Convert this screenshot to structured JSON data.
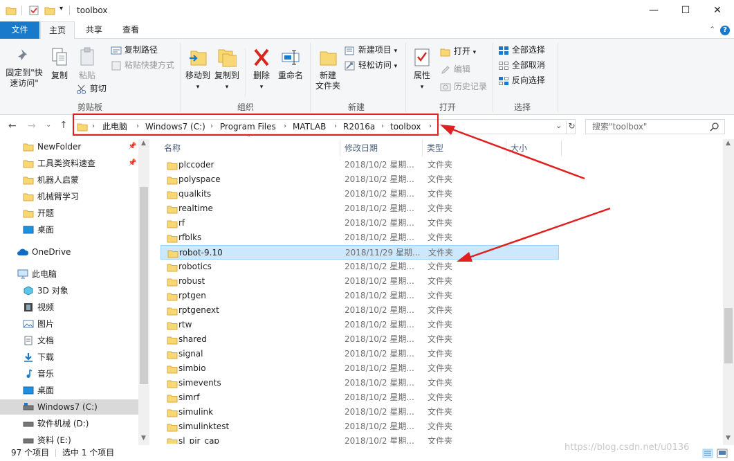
{
  "window": {
    "title": "toolbox",
    "controls": {
      "minimize": "—",
      "maximize": "☐",
      "close": "✕"
    }
  },
  "ribbon_tabs": [
    {
      "label": "文件"
    },
    {
      "label": "主页"
    },
    {
      "label": "共享"
    },
    {
      "label": "查看"
    }
  ],
  "ribbon": {
    "clipboard": {
      "group_label": "剪贴板",
      "pin_quick_line1": "固定到\"快",
      "pin_quick_line2": "速访问\"",
      "copy": "复制",
      "paste": "粘贴",
      "copy_path": "复制路径",
      "paste_shortcut": "粘贴快捷方式",
      "cut": "剪切"
    },
    "organize": {
      "group_label": "组织",
      "move_to": "移动到",
      "copy_to": "复制到",
      "delete": "删除",
      "rename": "重命名"
    },
    "new": {
      "group_label": "新建",
      "new_folder_line1": "新建",
      "new_folder_line2": "文件夹",
      "new_item": "新建项目",
      "easy_access": "轻松访问"
    },
    "open": {
      "group_label": "打开",
      "properties": "属性",
      "open": "打开",
      "edit": "编辑",
      "history": "历史记录"
    },
    "select": {
      "group_label": "选择",
      "select_all": "全部选择",
      "select_none": "全部取消",
      "invert": "反向选择"
    }
  },
  "address": {
    "crumbs": [
      "此电脑",
      "Windows7 (C:)",
      "Program Files",
      "MATLAB",
      "R2016a",
      "toolbox"
    ],
    "search_placeholder": "搜索\"toolbox\""
  },
  "nav_pane": {
    "quick_access": [
      "NewFolder",
      "工具类资料速查",
      "机器人启蒙",
      "机械臂学习",
      "开题",
      "桌面"
    ],
    "onedrive": "OneDrive",
    "this_pc": "此电脑",
    "pc_items": [
      "3D 对象",
      "视频",
      "图片",
      "文档",
      "下载",
      "音乐",
      "桌面"
    ],
    "drives": [
      "Windows7 (C:)",
      "软件机械 (D:)",
      "资料 (E:)"
    ]
  },
  "columns": {
    "name": "名称",
    "date": "修改日期",
    "type": "类型",
    "size": "大小"
  },
  "files": [
    {
      "name": "plccoder",
      "date": "2018/10/2 星期...",
      "type": "文件夹"
    },
    {
      "name": "polyspace",
      "date": "2018/10/2 星期...",
      "type": "文件夹"
    },
    {
      "name": "qualkits",
      "date": "2018/10/2 星期...",
      "type": "文件夹"
    },
    {
      "name": "realtime",
      "date": "2018/10/2 星期...",
      "type": "文件夹"
    },
    {
      "name": "rf",
      "date": "2018/10/2 星期...",
      "type": "文件夹"
    },
    {
      "name": "rfblks",
      "date": "2018/10/2 星期...",
      "type": "文件夹"
    },
    {
      "name": "robot-9.10",
      "date": "2018/11/29 星期...",
      "type": "文件夹"
    },
    {
      "name": "robotics",
      "date": "2018/10/2 星期...",
      "type": "文件夹"
    },
    {
      "name": "robust",
      "date": "2018/10/2 星期...",
      "type": "文件夹"
    },
    {
      "name": "rptgen",
      "date": "2018/10/2 星期...",
      "type": "文件夹"
    },
    {
      "name": "rptgenext",
      "date": "2018/10/2 星期...",
      "type": "文件夹"
    },
    {
      "name": "rtw",
      "date": "2018/10/2 星期...",
      "type": "文件夹"
    },
    {
      "name": "shared",
      "date": "2018/10/2 星期...",
      "type": "文件夹"
    },
    {
      "name": "signal",
      "date": "2018/10/2 星期...",
      "type": "文件夹"
    },
    {
      "name": "simbio",
      "date": "2018/10/2 星期...",
      "type": "文件夹"
    },
    {
      "name": "simevents",
      "date": "2018/10/2 星期...",
      "type": "文件夹"
    },
    {
      "name": "simrf",
      "date": "2018/10/2 星期...",
      "type": "文件夹"
    },
    {
      "name": "simulink",
      "date": "2018/10/2 星期...",
      "type": "文件夹"
    },
    {
      "name": "simulinktest",
      "date": "2018/10/2 星期...",
      "type": "文件夹"
    },
    {
      "name": "sl_pir_cap",
      "date": "2018/10/2 星期...",
      "type": "文件夹"
    }
  ],
  "status": {
    "item_count": "97 个项目",
    "selected": "选中 1 个项目"
  },
  "watermark": "https://blog.csdn.net/u0136",
  "colors": {
    "accent": "#1979ca",
    "selection": "#cce8ff",
    "annotation": "#e0201f",
    "folder": "#f8d775"
  }
}
